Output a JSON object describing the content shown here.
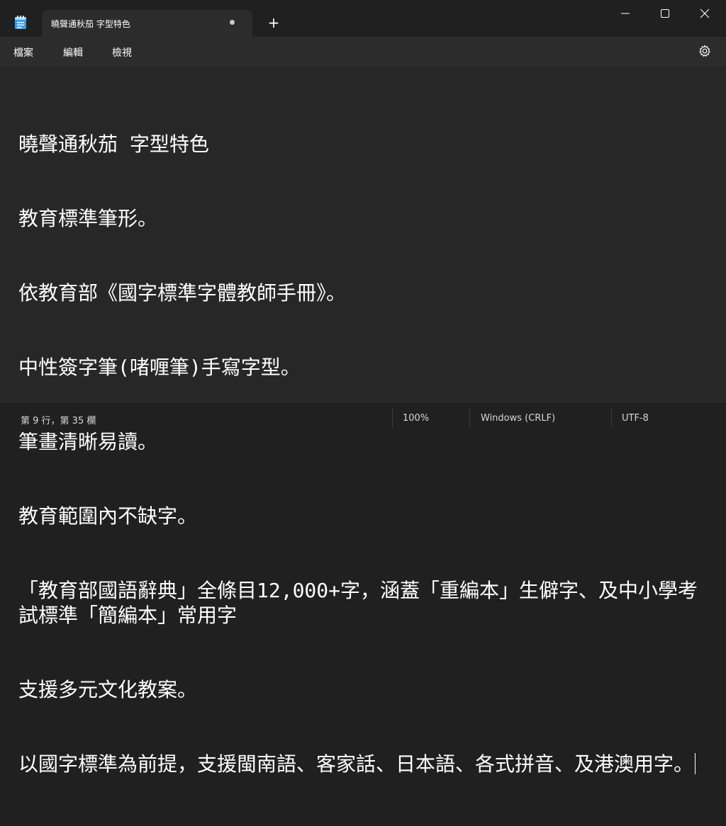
{
  "window": {
    "app_icon": "notepad-icon",
    "tab_title": "曉聲通秋茄 字型特色",
    "tab_modified_indicator": "unsaved-dot-icon",
    "new_tab_label": "+"
  },
  "menu": {
    "items": [
      "檔案",
      "編輯",
      "檢視"
    ],
    "settings_icon": "gear-icon"
  },
  "editor": {
    "lines": [
      "曉聲通秋茄 字型特色",
      "教育標準筆形。",
      "依教育部《國字標準字體教師手冊》。",
      "中性簽字筆(啫喱筆)手寫字型。",
      "筆畫清晰易讀。",
      "教育範圍內不缺字。",
      "「教育部國語辭典」全條目12,000+字，涵蓋「重編本」生僻字、及中小學考試標準「簡編本」常用字",
      "支援多元文化教案。",
      "以國字標準為前提，支援閩南語、客家話、日本語、各式拼音、及港澳用字。"
    ]
  },
  "status": {
    "position": "第 9 行，第 35 欄",
    "zoom": "100%",
    "line_ending": "Windows (CRLF)",
    "encoding": "UTF-8"
  },
  "colors": {
    "background": "#202020",
    "editor": "#272727",
    "text": "#ffffff"
  }
}
